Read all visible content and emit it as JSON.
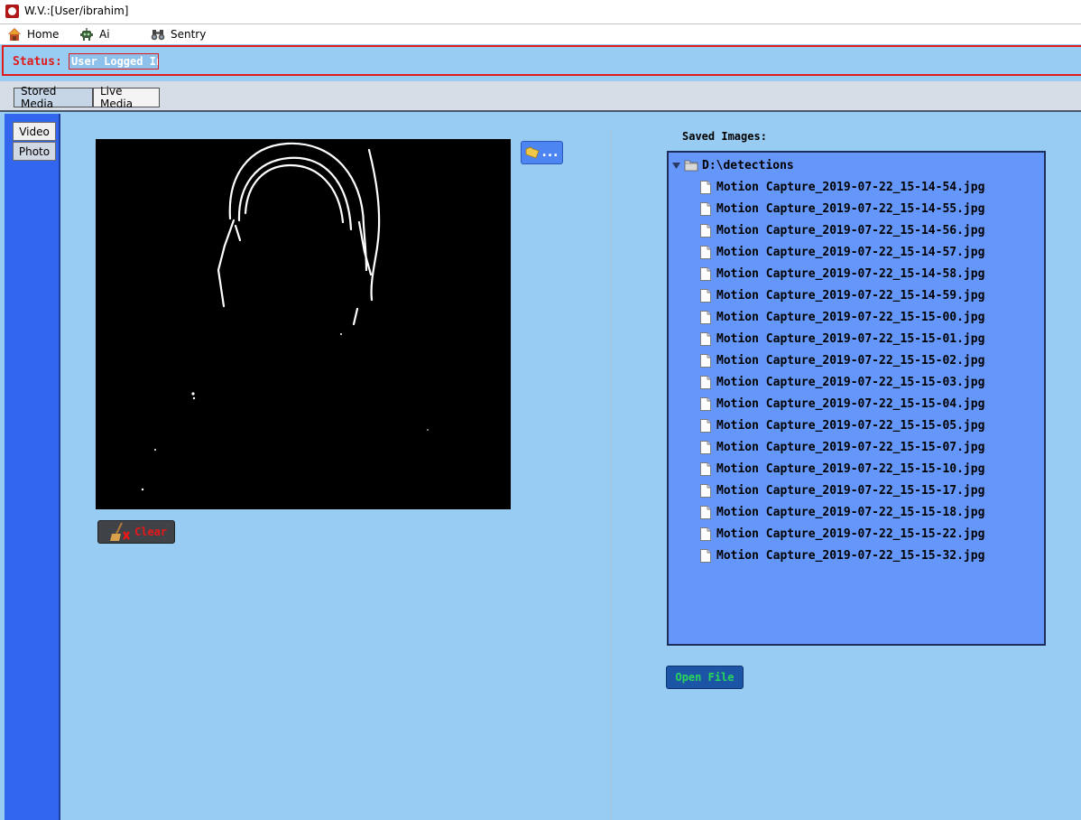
{
  "window": {
    "title": "W.V.:[User/ibrahim]",
    "icon": "app-logo-icon"
  },
  "menu": [
    {
      "label": "Home",
      "icon": "house-icon"
    },
    {
      "label": "Ai",
      "icon": "robot-icon"
    },
    {
      "label": "Sentry",
      "icon": "binoculars-icon"
    }
  ],
  "status": {
    "label": "Status:",
    "value": "User Logged In"
  },
  "tabs": [
    {
      "label": "Stored Media",
      "active": true
    },
    {
      "label": "Live Media",
      "active": false
    }
  ],
  "side_buttons": [
    {
      "label": "Video",
      "active": false
    },
    {
      "label": "Photo",
      "active": true
    }
  ],
  "viewer": {
    "browse_button": {
      "icon": "folder-icon",
      "label": "..."
    },
    "clear_button": {
      "icon": "broom-icon",
      "label": "Clear"
    }
  },
  "saved_images": {
    "label": "Saved Images:",
    "root": "D:\\detections",
    "files": [
      "Motion Capture_2019-07-22_15-14-54.jpg",
      "Motion Capture_2019-07-22_15-14-55.jpg",
      "Motion Capture_2019-07-22_15-14-56.jpg",
      "Motion Capture_2019-07-22_15-14-57.jpg",
      "Motion Capture_2019-07-22_15-14-58.jpg",
      "Motion Capture_2019-07-22_15-14-59.jpg",
      "Motion Capture_2019-07-22_15-15-00.jpg",
      "Motion Capture_2019-07-22_15-15-01.jpg",
      "Motion Capture_2019-07-22_15-15-02.jpg",
      "Motion Capture_2019-07-22_15-15-03.jpg",
      "Motion Capture_2019-07-22_15-15-04.jpg",
      "Motion Capture_2019-07-22_15-15-05.jpg",
      "Motion Capture_2019-07-22_15-15-07.jpg",
      "Motion Capture_2019-07-22_15-15-10.jpg",
      "Motion Capture_2019-07-22_15-15-17.jpg",
      "Motion Capture_2019-07-22_15-15-18.jpg",
      "Motion Capture_2019-07-22_15-15-22.jpg",
      "Motion Capture_2019-07-22_15-15-32.jpg"
    ],
    "open_button": "Open File"
  },
  "colors": {
    "background": "#99ccf2",
    "status_red": "#e01a1a",
    "side_strip": "#3366ee",
    "tree_bg": "#6497f9",
    "open_text": "#29d65a"
  }
}
